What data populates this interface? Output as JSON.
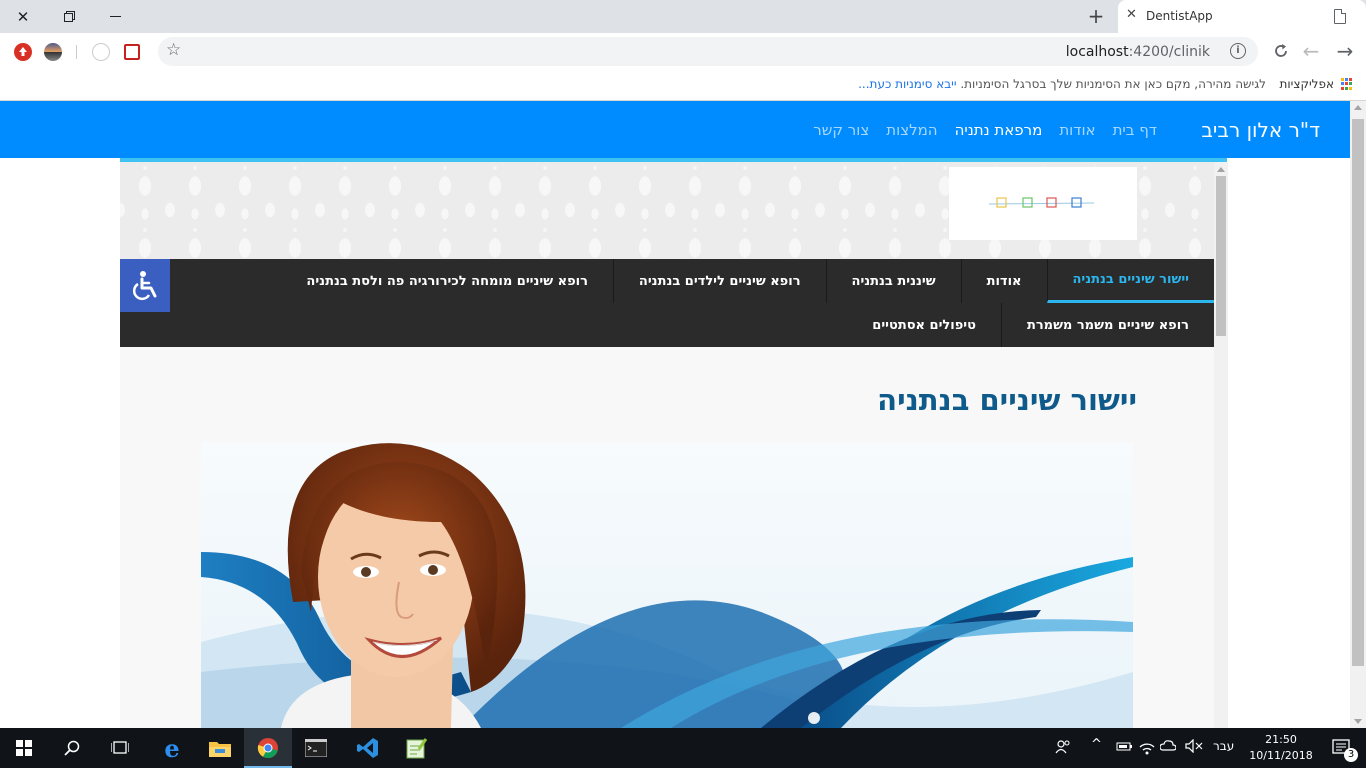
{
  "browser": {
    "tab_title": "DentistApp",
    "url_host": "localhost",
    "url_path": ":4200/clinik",
    "bookmarks_apps_label": "אפליקציות",
    "bookmarks_hint": "לגישה מהירה, מקם כאן את הסימניות שלך בסרגל הסימניות.",
    "bookmarks_import_link": "ייבא סימניות כעת..."
  },
  "site_nav": {
    "brand": "ד\"ר אלון רביב",
    "items": [
      {
        "label": "דף בית",
        "active": false
      },
      {
        "label": "אודות",
        "active": false
      },
      {
        "label": "מרפאת נתניה",
        "active": true
      },
      {
        "label": "המלצות",
        "active": false
      },
      {
        "label": "צור קשר",
        "active": false
      }
    ]
  },
  "category_nav": {
    "row1": [
      {
        "label": "יישור שיניים בנתניה",
        "active": true
      },
      {
        "label": "אודות",
        "active": false
      },
      {
        "label": "שיננית בנתניה",
        "active": false
      },
      {
        "label": "רופא שיניים לילדים בנתניה",
        "active": false
      },
      {
        "label": "רופא שיניים מומחה לכירורגיה פה ולסת בנתניה",
        "active": false
      }
    ],
    "row2": [
      {
        "label": "רופא שיניים משמר משמרת",
        "active": false
      },
      {
        "label": "טיפולים אסתטיים",
        "active": false
      }
    ]
  },
  "content": {
    "page_title": "יישור שיניים בנתניה"
  },
  "taskbar": {
    "language": "עבר",
    "time": "21:50",
    "date": "10/11/2018",
    "notification_count": "3"
  },
  "colors": {
    "site_nav_bg": "#008cff",
    "accent_stripe": "#3ec1f3",
    "category_nav_bg": "#2b2b2b",
    "category_active": "#2bb6ef",
    "page_title": "#0e5a8a",
    "accessibility_button": "#3b5fc0"
  }
}
